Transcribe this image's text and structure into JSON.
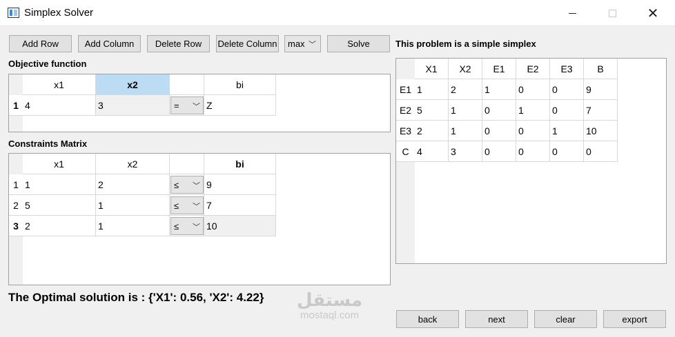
{
  "window": {
    "title": "Simplex Solver"
  },
  "toolbar": {
    "add_row": "Add Row",
    "add_column": "Add Column",
    "delete_row": "Delete Row",
    "delete_column": "Delete Column",
    "mode": "max",
    "solve": "Solve"
  },
  "objective": {
    "label": "Objective function",
    "headers": [
      "x1",
      "x2",
      "",
      "bi"
    ],
    "row_header": "1",
    "values": [
      "4",
      "3"
    ],
    "relation": "=",
    "rhs": "Z"
  },
  "constraints": {
    "label": "Constraints Matrix",
    "headers": [
      "x1",
      "x2",
      "",
      "bi"
    ],
    "rows": [
      {
        "header": "1",
        "values": [
          "1",
          "2"
        ],
        "relation": "≤",
        "rhs": "9"
      },
      {
        "header": "2",
        "values": [
          "5",
          "1"
        ],
        "relation": "≤",
        "rhs": "7"
      },
      {
        "header": "3",
        "values": [
          "2",
          "1"
        ],
        "relation": "≤",
        "rhs": "10"
      }
    ]
  },
  "result": {
    "text": "The Optimal solution is : {'X1': 0.56, 'X2': 4.22}"
  },
  "tableau": {
    "status": "This problem is a simple simplex",
    "headers": [
      "X1",
      "X2",
      "E1",
      "E2",
      "E3",
      "B"
    ],
    "rows": [
      {
        "header": "E1",
        "values": [
          "1",
          "2",
          "1",
          "0",
          "0",
          "9"
        ]
      },
      {
        "header": "E2",
        "values": [
          "5",
          "1",
          "0",
          "1",
          "0",
          "7"
        ]
      },
      {
        "header": "E3",
        "values": [
          "2",
          "1",
          "0",
          "0",
          "1",
          "10"
        ]
      },
      {
        "header": "C",
        "values": [
          "4",
          "3",
          "0",
          "0",
          "0",
          "0"
        ]
      }
    ]
  },
  "nav": {
    "back": "back",
    "next": "next",
    "clear": "clear",
    "export": "export"
  },
  "watermark": {
    "arabic": "مستقل",
    "latin": "mostaql.com"
  }
}
